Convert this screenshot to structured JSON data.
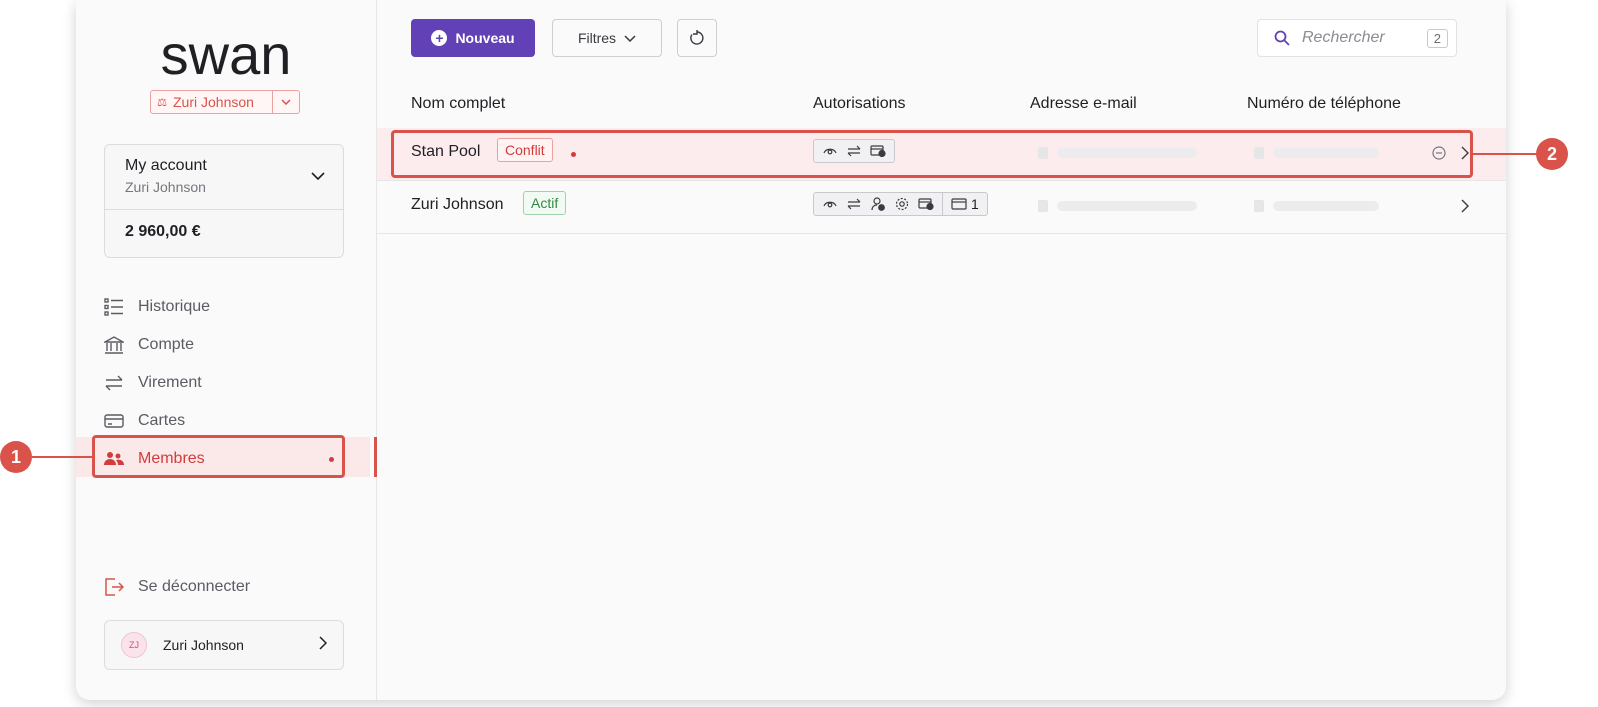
{
  "brand": {
    "logo_text": "swan",
    "project_name": "Zuri Johnson"
  },
  "account": {
    "name": "My account",
    "holder": "Zuri Johnson",
    "balance": "2 960,00 €"
  },
  "nav": {
    "items": [
      {
        "label": "Historique",
        "icon": "history-list-icon"
      },
      {
        "label": "Compte",
        "icon": "bank-icon"
      },
      {
        "label": "Virement",
        "icon": "transfer-arrows-icon"
      },
      {
        "label": "Cartes",
        "icon": "card-icon"
      },
      {
        "label": "Membres",
        "icon": "members-icon",
        "active": true
      }
    ]
  },
  "footer": {
    "logout_label": "Se déconnecter",
    "user_initials": "ZJ",
    "user_name": "Zuri Johnson"
  },
  "toolbar": {
    "new_label": "Nouveau",
    "filter_label": "Filtres",
    "search_placeholder": "Rechercher",
    "search_count": "2"
  },
  "table": {
    "headers": {
      "name": "Nom complet",
      "permissions": "Autorisations",
      "email": "Adresse e-mail",
      "phone": "Numéro de téléphone"
    },
    "rows": [
      {
        "name": "Stan Pool",
        "status": "Conflit",
        "permission_icons": [
          "view-icon",
          "transfer-icon",
          "card-add-icon"
        ]
      },
      {
        "name": "Zuri Johnson",
        "status": "Actif",
        "permission_icons": [
          "view-icon",
          "transfer-icon",
          "user-add-icon",
          "settings-icon",
          "card-add-icon"
        ],
        "card_count": "1"
      }
    ]
  },
  "annotations": {
    "marker_1": "1",
    "marker_2": "2"
  },
  "colors": {
    "accent": "#6240b5",
    "highlight": "#d9534a",
    "conflict": "#d23c3c",
    "active": "#2f8a45"
  }
}
